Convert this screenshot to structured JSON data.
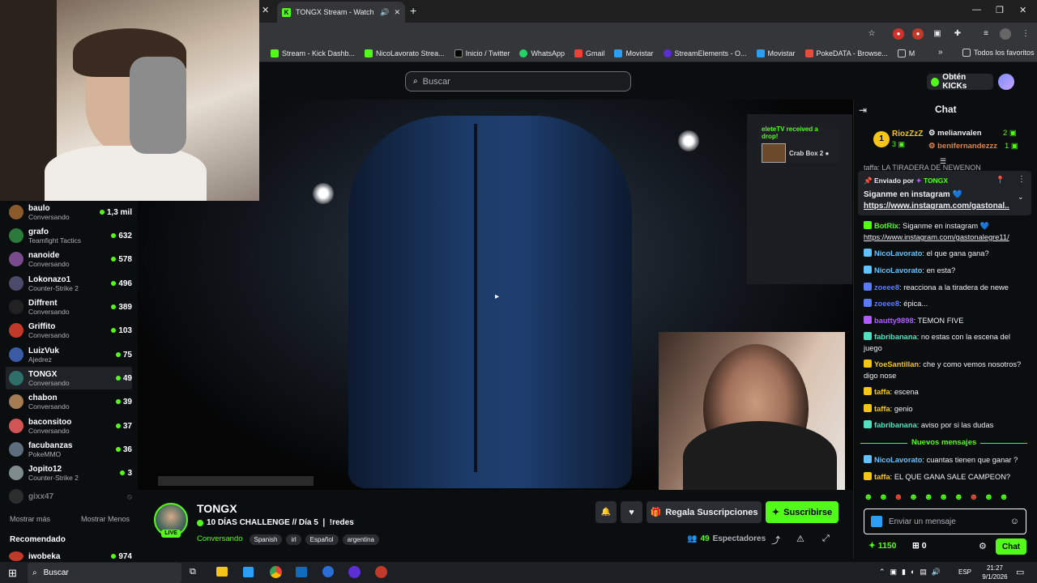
{
  "browser": {
    "tab_title": "TONGX Stream - Watch Liv",
    "bookmarks": [
      "Stream - Kick Dashb...",
      "NicoLavorato Strea...",
      "Inicio / Twitter",
      "WhatsApp",
      "Gmail",
      "Movistar",
      "StreamElements - O...",
      "Movistar",
      "PokeDATA - Browse...",
      "M"
    ],
    "all_bookmarks": "Todos los favoritos"
  },
  "header": {
    "search_placeholder": "Buscar",
    "kicks_label": "Obtén KICKs"
  },
  "sidebar": {
    "channels": [
      {
        "name": "baulo",
        "category": "Conversando",
        "viewers": "1,3 mil",
        "color": "#8b5a2b"
      },
      {
        "name": "grafo",
        "category": "Teamfight Tactics",
        "viewers": "632",
        "color": "#2b7a3b"
      },
      {
        "name": "nanoide",
        "category": "Conversando",
        "viewers": "578",
        "color": "#7a4b8c"
      },
      {
        "name": "Lokonazo1",
        "category": "Counter-Strike 2",
        "viewers": "496",
        "color": "#4a4a6a"
      },
      {
        "name": "Diffrent",
        "category": "Conversando",
        "viewers": "389",
        "color": "#222222"
      },
      {
        "name": "Griffito",
        "category": "Conversando",
        "viewers": "103",
        "color": "#c0392b"
      },
      {
        "name": "LuizVuk",
        "category": "Ajedrez",
        "viewers": "75",
        "color": "#3b5ba5"
      },
      {
        "name": "TONGX",
        "category": "Conversando",
        "viewers": "49",
        "color": "#2f6f6a"
      },
      {
        "name": "chabon",
        "category": "Conversando",
        "viewers": "39",
        "color": "#a67c52"
      },
      {
        "name": "baconsitoo",
        "category": "Conversando",
        "viewers": "37",
        "color": "#d35454"
      },
      {
        "name": "facubanzas",
        "category": "PokeMMO",
        "viewers": "36",
        "color": "#5d6d7e"
      },
      {
        "name": "Jopito12",
        "category": "Counter-Strike 2",
        "viewers": "3",
        "color": "#7f8c8d"
      }
    ],
    "offline_channel": "gixx47",
    "show_more": "Mostrar más",
    "show_less": "Mostrar Menos",
    "recommended_title": "Recomendado",
    "recommended": {
      "name": "iwobeka",
      "viewers": "974"
    }
  },
  "player": {
    "drop_title": "eleteTV received a drop!",
    "drop_item": "Crab Box 2 ●"
  },
  "stream": {
    "channel": "TONGX",
    "live_badge": "LIVE",
    "title": "10 DÍAS CHALLENGE // Día 5 ❘ !redes",
    "category": "Conversando",
    "tags": [
      "Spanish",
      "irl",
      "Español",
      "argentina"
    ],
    "gift_label": "Regala Suscripciones",
    "subscribe_label": "Suscribirse",
    "viewers": "49",
    "viewers_label": "Espectadores"
  },
  "chat": {
    "title": "Chat",
    "leaderboard": {
      "first": "RiozZzZ",
      "first_points": "3",
      "second": "melianvalen",
      "second_points": "2",
      "third": "benifernandezzz",
      "third_points": "1"
    },
    "pinned": {
      "by_label": "Enviado por",
      "by_user": "TONGX",
      "text": "Siganme en instagram 💙",
      "link": "https://www.instagram.com/gastonal..."
    },
    "partial_line": "taffa: LA TIRADERA DE NEWENON",
    "messages": [
      {
        "user": "BotRix",
        "text": "Siganme en instagram 💙",
        "link": "https://www.instagram.com/gastonalegre11/",
        "color": "#53fc18"
      },
      {
        "user": "NicoLavorato",
        "text": "el que gana gana?",
        "color": "#61c2ff"
      },
      {
        "user": "NicoLavorato",
        "text": "en esta?",
        "color": "#61c2ff"
      },
      {
        "user": "zoeee8",
        "text": "reacciona a la tiradera de newe",
        "color": "#5b7bff"
      },
      {
        "user": "zoeee8",
        "text": "épica...",
        "color": "#5b7bff"
      },
      {
        "user": "bautty9898",
        "text": "TEMON FIVE",
        "color": "#b05cff"
      },
      {
        "user": "fabribanana",
        "text": "no estas con la escena del juego",
        "color": "#53e0c0"
      },
      {
        "user": "YoeSantillan",
        "text": "che y como vemos nosotros? digo nose",
        "color": "#f5c518"
      },
      {
        "user": "taffa",
        "text": "escena",
        "color": "#f5c518"
      },
      {
        "user": "taffa",
        "text": "genio",
        "color": "#f5c518"
      },
      {
        "user": "fabribanana",
        "text": "aviso por si las dudas",
        "color": "#53e0c0"
      }
    ],
    "new_messages_label": "Nuevos mensajes",
    "new_messages": [
      {
        "user": "NicoLavorato",
        "text": "cuantas tienen que ganar ?",
        "color": "#61c2ff"
      },
      {
        "user": "taffa",
        "text": "EL QUE GANA SALE CAMPEON?",
        "color": "#f5c518"
      }
    ],
    "input_placeholder": "Enviar un mensaje",
    "points": "1150",
    "gifts": "0",
    "send_label": "Chat"
  },
  "taskbar": {
    "search": "Buscar",
    "lang": "ESP",
    "time": "21:27",
    "date": "9/1/2026"
  }
}
